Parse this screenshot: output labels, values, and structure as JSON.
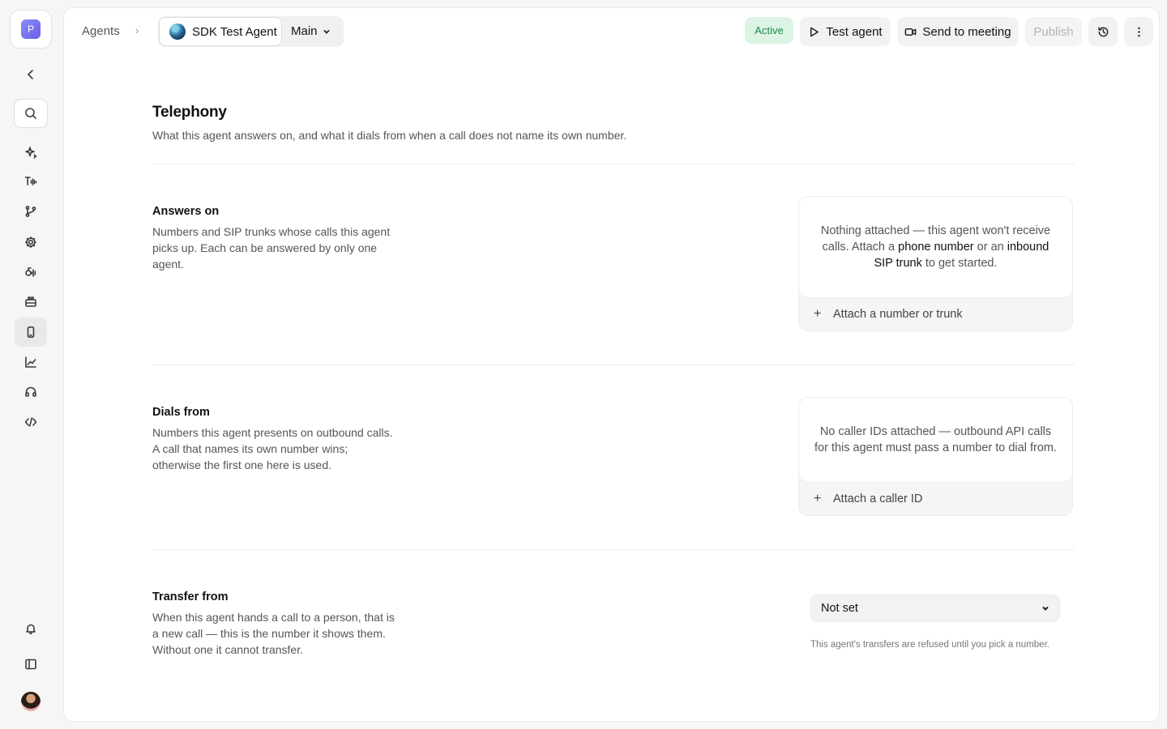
{
  "workspace": {
    "initial": "P"
  },
  "header": {
    "breadcrumb_root": "Agents",
    "breadcrumb_sep": "›",
    "agent_name": "SDK Test Agent",
    "branch": "Main",
    "status": "Active",
    "test_label": "Test agent",
    "meeting_label": "Send to meeting",
    "publish_label": "Publish"
  },
  "page": {
    "title": "Telephony",
    "subtitle": "What this agent answers on, and what it dials from when a call does not name its own number."
  },
  "answers_on": {
    "title": "Answers on",
    "description": "Numbers and SIP trunks whose calls this agent picks up. Each can be answered by only one agent.",
    "empty_pre": "Nothing attached — this agent won't receive calls. Attach a ",
    "empty_link1": "phone number",
    "empty_mid": " or an ",
    "empty_link2": "inbound SIP trunk",
    "empty_post": " to get started.",
    "action": "Attach a number or trunk"
  },
  "dials_from": {
    "title": "Dials from",
    "description": "Numbers this agent presents on outbound calls. A call that names its own number wins; otherwise the first one here is used.",
    "empty": "No caller IDs attached — outbound API calls for this agent must pass a number to dial from.",
    "action": "Attach a caller ID"
  },
  "transfer_from": {
    "title": "Transfer from",
    "description": "When this agent hands a call to a person, that is a new call — this is the number it shows them. Without one it cannot transfer.",
    "selected": "Not set",
    "hint": "This agent's transfers are refused until you pick a number."
  },
  "icons": {
    "collapse": "chevron-left-icon",
    "search": "search-icon",
    "nav": [
      "sparkle-icon",
      "text-voice-icon",
      "branch-icon",
      "gear-icon",
      "voice-wave-icon",
      "toolbox-icon",
      "phone-icon",
      "chart-icon",
      "headset-icon",
      "code-icon"
    ],
    "bell": "bell-icon",
    "sidebar_toggle": "sidebar-icon"
  },
  "colors": {
    "status_bg": "#dcf3e5",
    "status_fg": "#1f8a4c",
    "accent": "#6a5ee8"
  }
}
